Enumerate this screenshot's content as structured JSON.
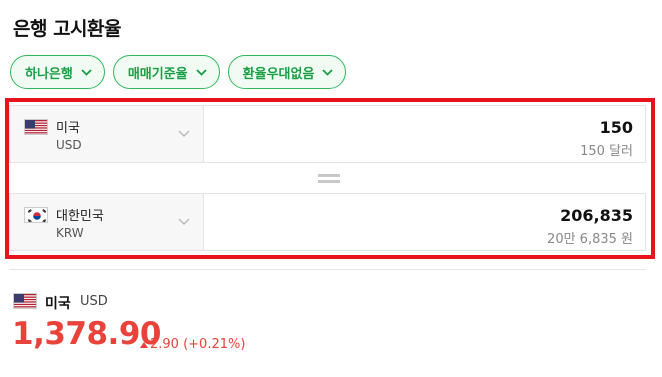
{
  "header": {
    "title": "은행 고시환율"
  },
  "filters": [
    {
      "label": "하나은행"
    },
    {
      "label": "매매기준율"
    },
    {
      "label": "환율우대없음"
    }
  ],
  "converter": {
    "from": {
      "name": "미국",
      "code": "USD",
      "amount": "150",
      "amount_text": "150 달러",
      "flag": "us-flag-icon"
    },
    "to": {
      "name": "대한민국",
      "code": "KRW",
      "amount": "206,835",
      "amount_text": "20만 6,835 원",
      "flag": "kr-flag-icon"
    }
  },
  "rate_summary": {
    "name": "미국",
    "code": "USD",
    "rate": "1,378.90",
    "change": "2.90 (+0.21%)",
    "direction": "up"
  },
  "colors": {
    "accent_green": "#2fb85a",
    "highlight_red": "#e8121d",
    "rate_red": "#e8423b"
  }
}
